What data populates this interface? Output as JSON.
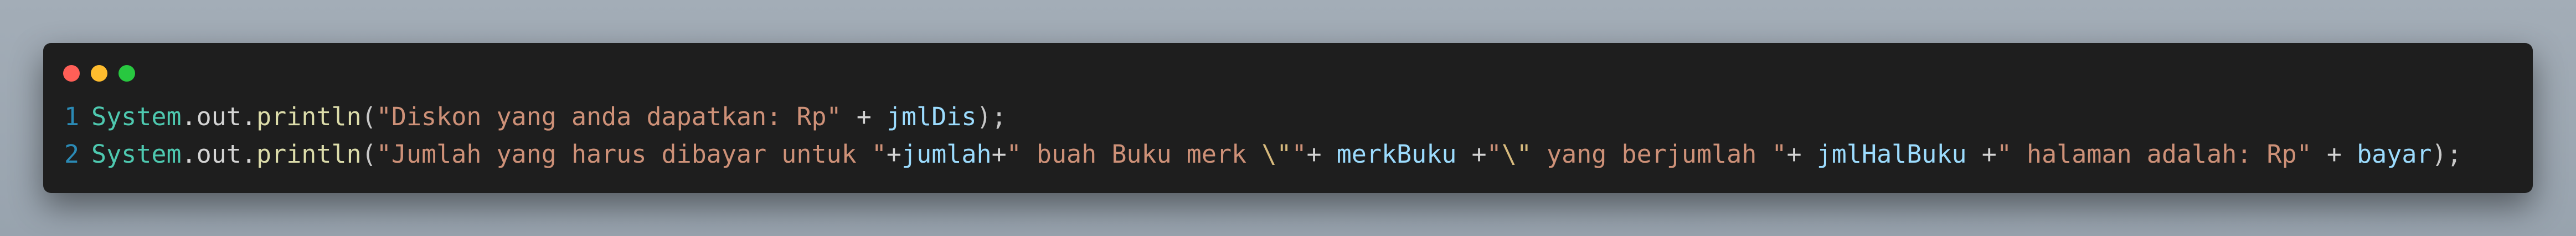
{
  "window_controls": {
    "close_color": "#ff5f57",
    "minimize_color": "#febc2e",
    "maximize_color": "#28c840"
  },
  "code_lines": [
    {
      "number": "1",
      "tokens": [
        {
          "t": "class",
          "v": "System"
        },
        {
          "t": "plain",
          "v": ".out."
        },
        {
          "t": "fn",
          "v": "println"
        },
        {
          "t": "punc",
          "v": "("
        },
        {
          "t": "str",
          "v": "\"Diskon yang anda dapatkan: Rp\""
        },
        {
          "t": "op",
          "v": " + "
        },
        {
          "t": "var",
          "v": "jmlDis"
        },
        {
          "t": "punc",
          "v": ");"
        }
      ]
    },
    {
      "number": "2",
      "tokens": [
        {
          "t": "class",
          "v": "System"
        },
        {
          "t": "plain",
          "v": ".out."
        },
        {
          "t": "fn",
          "v": "println"
        },
        {
          "t": "punc",
          "v": "("
        },
        {
          "t": "str",
          "v": "\"Jumlah yang harus dibayar untuk \""
        },
        {
          "t": "op",
          "v": "+"
        },
        {
          "t": "var",
          "v": "jumlah"
        },
        {
          "t": "op",
          "v": "+"
        },
        {
          "t": "str",
          "v": "\" buah Buku merk "
        },
        {
          "t": "esc",
          "v": "\\\""
        },
        {
          "t": "str",
          "v": "\""
        },
        {
          "t": "op",
          "v": "+ "
        },
        {
          "t": "var",
          "v": "merkBuku"
        },
        {
          "t": "op",
          "v": " +"
        },
        {
          "t": "str",
          "v": "\""
        },
        {
          "t": "esc",
          "v": "\\\""
        },
        {
          "t": "str",
          "v": " yang berjumlah \""
        },
        {
          "t": "op",
          "v": "+ "
        },
        {
          "t": "var",
          "v": "jmlHalBuku"
        },
        {
          "t": "op",
          "v": " +"
        },
        {
          "t": "str",
          "v": "\" halaman adalah: Rp\""
        },
        {
          "t": "op",
          "v": " + "
        },
        {
          "t": "var",
          "v": "bayar"
        },
        {
          "t": "punc",
          "v": ");"
        }
      ]
    }
  ],
  "colors": {
    "background": "#1e1e1e",
    "line_number": "#2b8ab5",
    "class": "#4ec9b0",
    "function": "#dcdcaa",
    "string": "#ce9178",
    "variable": "#9cdcfe",
    "escape": "#d7ba7d"
  }
}
